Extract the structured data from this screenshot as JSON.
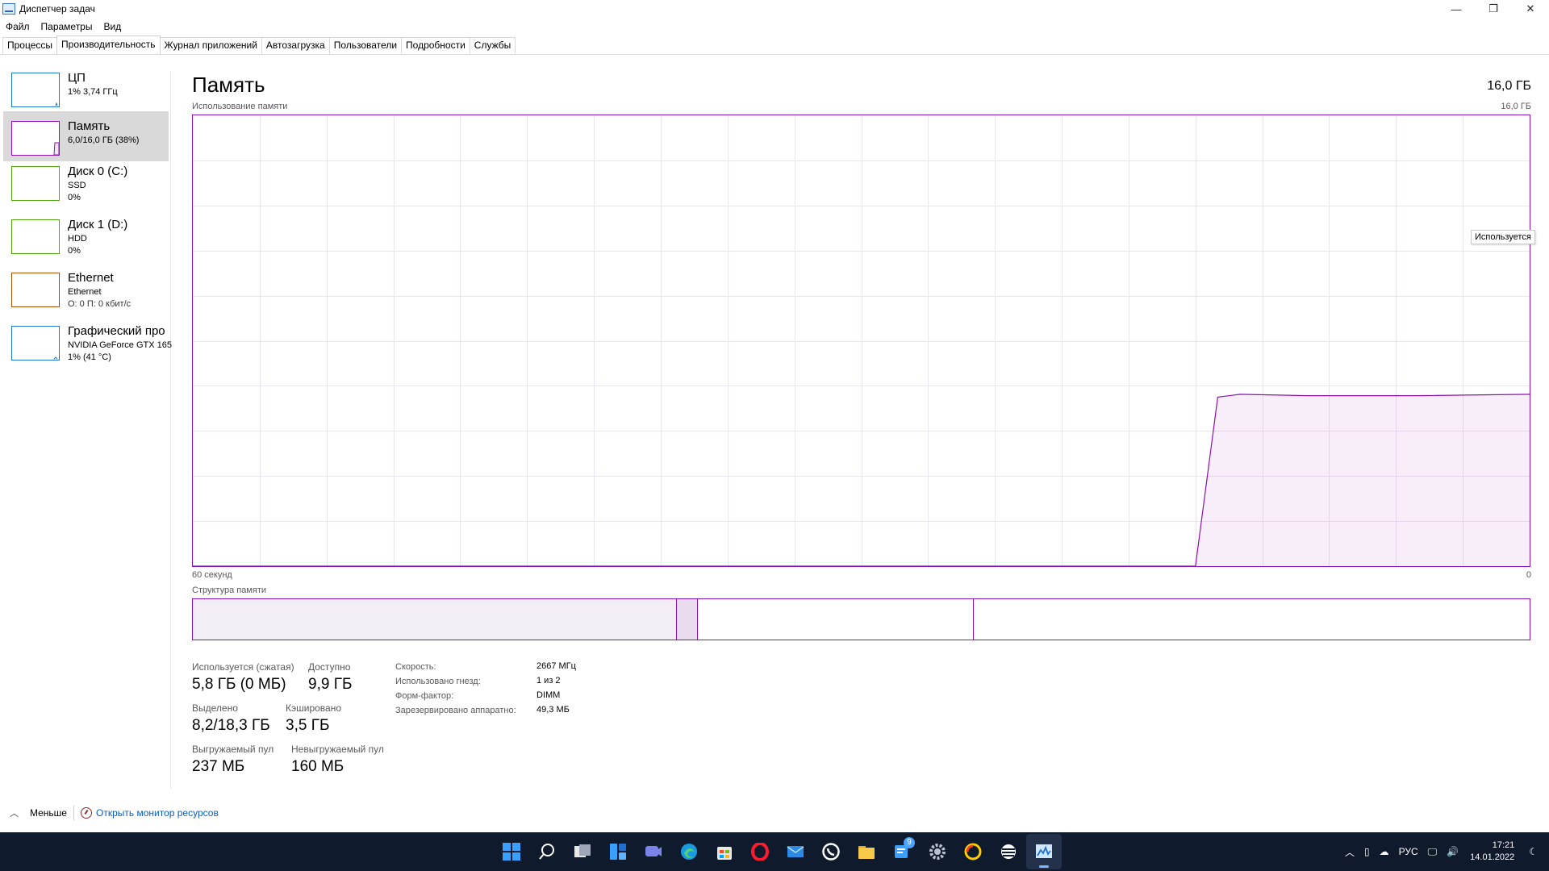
{
  "window": {
    "title": "Диспетчер задач",
    "controls": {
      "minimize": "—",
      "restore": "❐",
      "close": "✕"
    }
  },
  "menu": [
    "Файл",
    "Параметры",
    "Вид"
  ],
  "tabs": [
    "Процессы",
    "Производительность",
    "Журнал приложений",
    "Автозагрузка",
    "Пользователи",
    "Подробности",
    "Службы"
  ],
  "active_tab": "Производительность",
  "sidebar": {
    "items": [
      {
        "title": "ЦП",
        "sub1": "1% 3,74 ГГц",
        "sub2": "",
        "color": "#1a7ac4"
      },
      {
        "title": "Память",
        "sub1": "6,0/16,0 ГБ (38%)",
        "sub2": "",
        "color": "#8b12ae"
      },
      {
        "title": "Диск 0 (C:)",
        "sub1": "SSD",
        "sub2": "0%",
        "color": "#4da60c"
      },
      {
        "title": "Диск 1 (D:)",
        "sub1": "HDD",
        "sub2": "0%",
        "color": "#4da60c"
      },
      {
        "title": "Ethernet",
        "sub1": "Ethernet",
        "sub2": "О: 0 П: 0 кбит/с",
        "color": "#a74f01"
      },
      {
        "title": "Графический про",
        "sub1": "NVIDIA GeForce GTX 165",
        "sub2": "1% (41 °C)",
        "color": "#1a7ac4"
      }
    ],
    "selected": 1
  },
  "memory": {
    "title": "Память",
    "total": "16,0 ГБ",
    "usage_label": "Использование памяти",
    "graph_max": "16,0 ГБ",
    "time_left": "60 секунд",
    "time_right": "0",
    "tooltip": "Используется",
    "composition_label": "Структура памяти",
    "composition": {
      "in_use_fraction": 0.362,
      "modified_fraction": 0.016,
      "standby_fraction": 0.206
    },
    "stats": {
      "in_use_label": "Используется (сжатая)",
      "in_use_value": "5,8 ГБ (0 МБ)",
      "available_label": "Доступно",
      "available_value": "9,9 ГБ",
      "committed_label": "Выделено",
      "committed_value": "8,2/18,3 ГБ",
      "cached_label": "Кэшировано",
      "cached_value": "3,5 ГБ",
      "paged_label": "Выгружаемый пул",
      "paged_value": "237 МБ",
      "nonpaged_label": "Невыгружаемый пул",
      "nonpaged_value": "160 МБ"
    },
    "props": [
      {
        "label": "Скорость:",
        "value": "2667 МГц"
      },
      {
        "label": "Использовано гнезд:",
        "value": "1 из 2"
      },
      {
        "label": "Форм-фактор:",
        "value": "DIMM"
      },
      {
        "label": "Зарезервировано аппаратно:",
        "value": "49,3 МБ"
      }
    ]
  },
  "chart_data": {
    "type": "area",
    "title": "Использование памяти",
    "xlabel": "",
    "ylabel": "",
    "x": [
      60,
      50,
      40,
      30,
      20,
      15,
      14,
      13,
      10,
      5,
      0
    ],
    "series": [
      {
        "name": "Используется",
        "values": [
          0,
          0,
          0,
          0,
          0,
          0,
          6.0,
          6.1,
          6.05,
          6.05,
          6.1
        ]
      }
    ],
    "xlim": [
      60,
      0
    ],
    "ylim": [
      0,
      16
    ],
    "grid": true
  },
  "footer": {
    "less_label": "Меньше",
    "monitor_link": "Открыть монитор ресурсов"
  },
  "taskbar": {
    "icons": [
      "windows-start-icon",
      "search-icon",
      "task-view-icon",
      "widgets-icon",
      "teams-chat-icon",
      "edge-icon",
      "store-icon",
      "opera-icon",
      "mail-icon",
      "whatsapp-icon",
      "file-explorer-icon",
      "app-badge-icon",
      "settings-icon",
      "yandex-icon",
      "globe-app-icon",
      "task-manager-icon"
    ],
    "badge": "9",
    "lang": "РУС",
    "time": "17:21",
    "date": "14.01.2022"
  }
}
